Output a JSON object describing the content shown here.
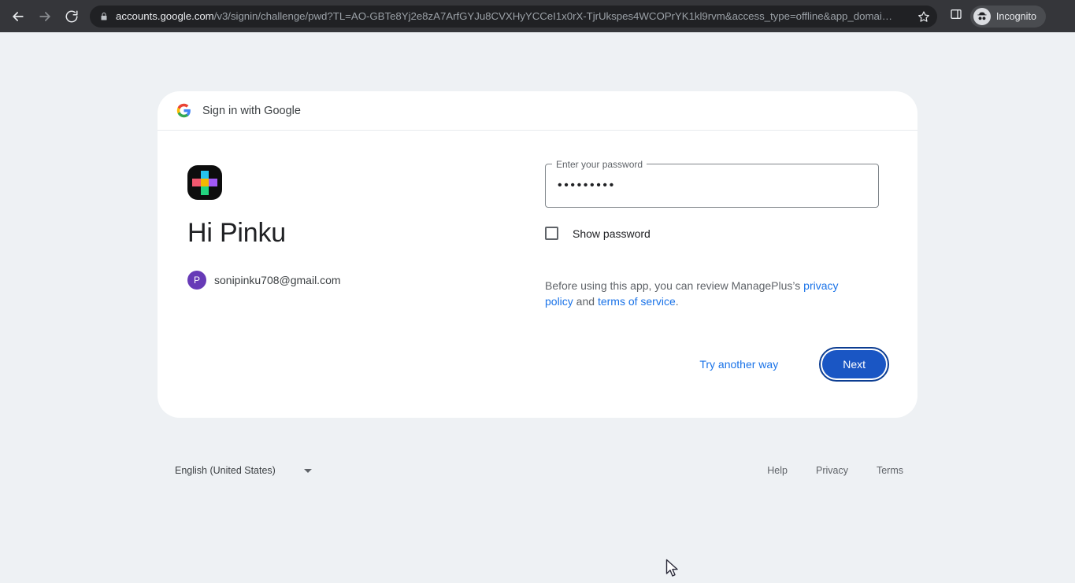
{
  "browser": {
    "back_icon": "back-arrow-icon",
    "forward_icon": "forward-arrow-icon",
    "reload_icon": "reload-icon",
    "lock_icon": "lock-icon",
    "url_host": "accounts.google.com",
    "url_path": "/v3/signin/challenge/pwd?TL=AO-GBTe8Yj2e8zA7ArfGYJu8CVXHyYCCeI1x0rX-TjrUkspes4WCOPrYK1kl9rvm&access_type=offline&app_domai…",
    "star_icon": "bookmark-star-icon",
    "side_panel_icon": "side-panel-icon",
    "profile_label": "Incognito",
    "profile_icon": "incognito-spy-icon",
    "menu_icon": "three-dot-menu-icon"
  },
  "card": {
    "header": {
      "logo_icon": "google-g-icon",
      "title": "Sign in with Google"
    },
    "app": {
      "logo_icon": "manageplus-app-icon",
      "colors": {
        "background": "#0d0d0d",
        "top": "#25c3f0",
        "left": "#f2586f",
        "right": "#a259f7",
        "bottom": "#22d47f",
        "center": "#f5b700"
      }
    },
    "greeting": "Hi Pinku",
    "account": {
      "avatar_initial": "P",
      "avatar_color": "#673ab7",
      "email": "sonipinku708@gmail.com"
    },
    "password_field": {
      "label": "Enter your password",
      "value": "•••••••••",
      "placeholder": "Enter your password",
      "char_count": 9
    },
    "show_password": {
      "label": "Show password",
      "checked": false
    },
    "consent": {
      "prefix": "Before using this app, you can review ManagePlus’s ",
      "link_privacy": "privacy policy",
      "middle": " and ",
      "link_terms": "terms of service",
      "suffix": "."
    },
    "actions": {
      "secondary_label": "Try another way",
      "primary_label": "Next",
      "primary_color": "#1a56c4",
      "focus_ring_color": "#0b3c91",
      "link_color": "#1a73e8"
    }
  },
  "footer": {
    "language": "English (United States)",
    "language_caret_icon": "chevron-down-icon",
    "links": [
      "Help",
      "Privacy",
      "Terms"
    ]
  },
  "theme": {
    "page_background": "#eef1f4",
    "card_background": "#ffffff",
    "chrome_background": "#35363a",
    "omnibox_background": "#202124"
  }
}
